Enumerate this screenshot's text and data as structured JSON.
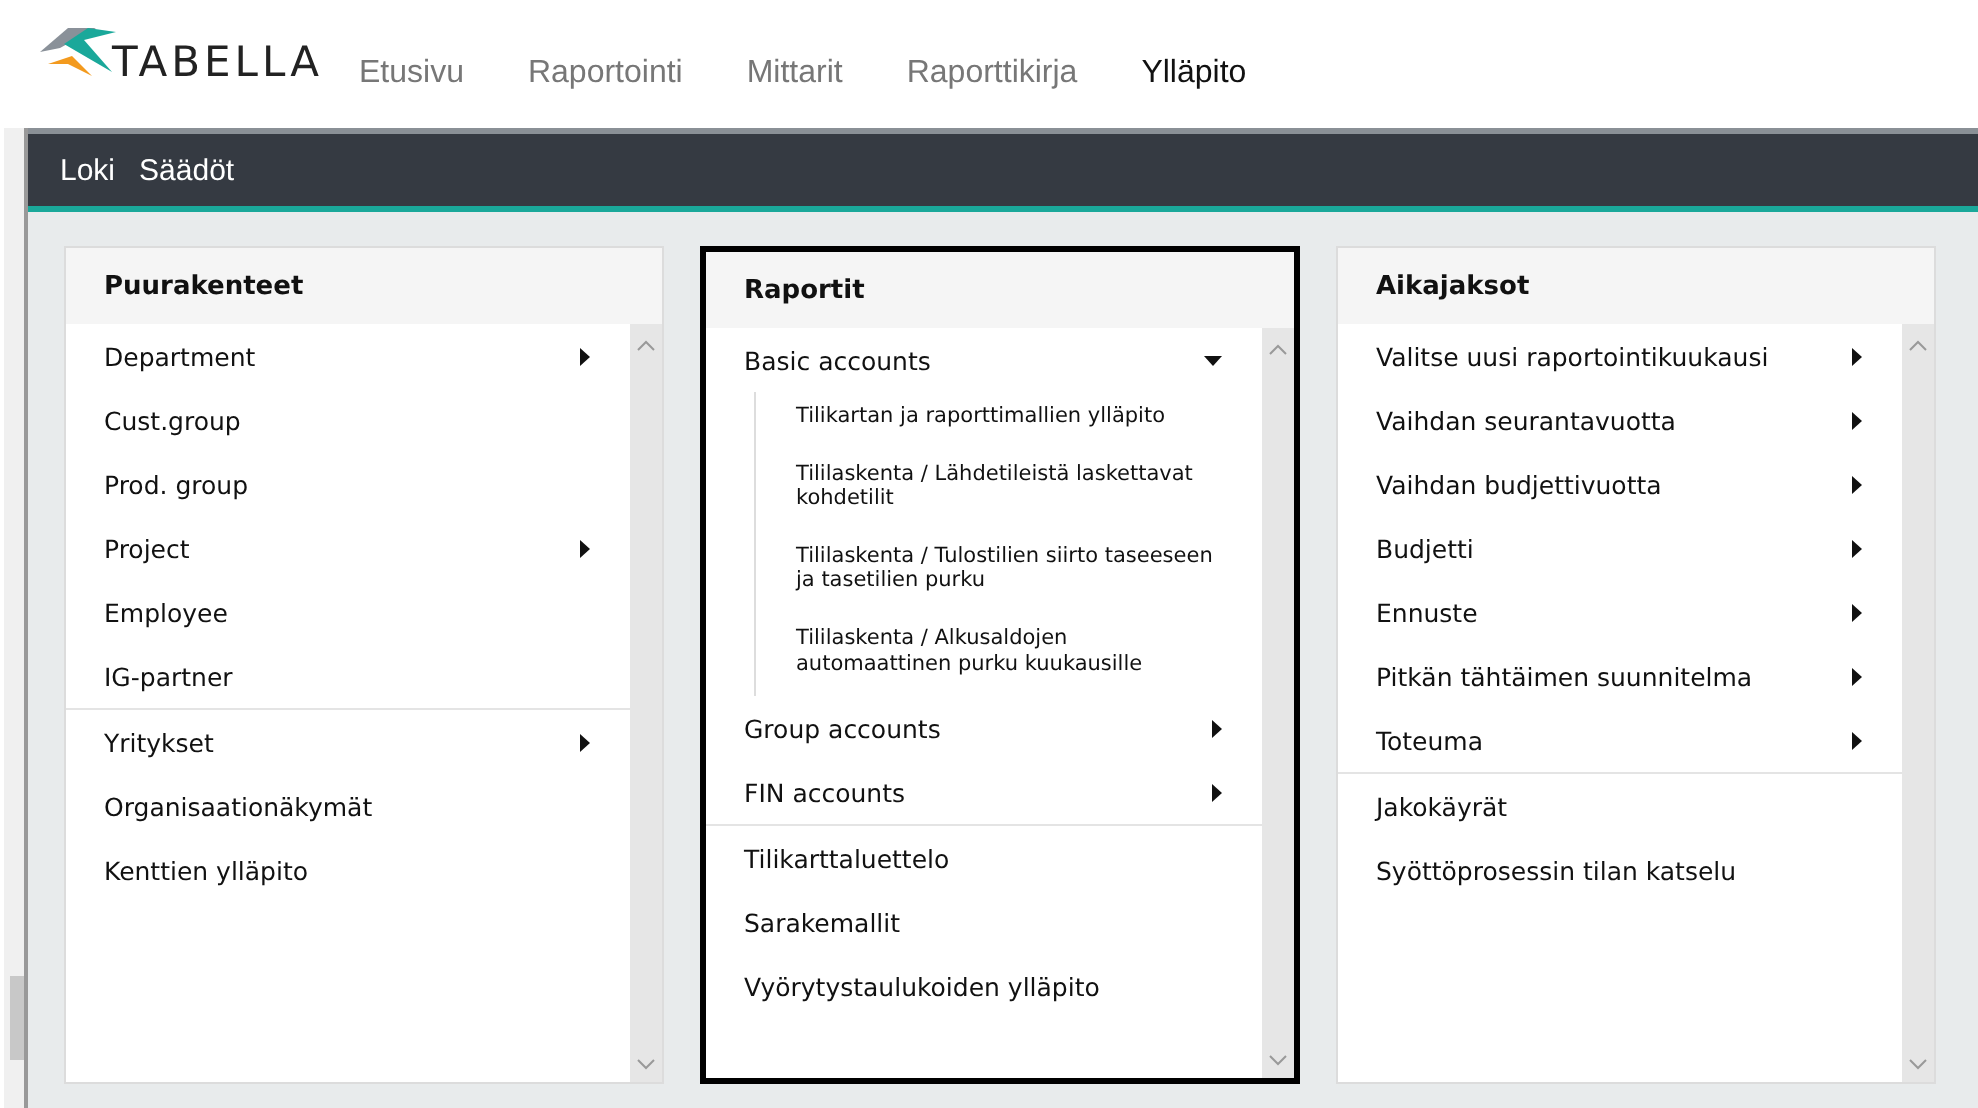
{
  "logo": {
    "text": "TABELLA"
  },
  "nav": [
    {
      "label": "Etusivu",
      "selected": false
    },
    {
      "label": "Raportointi",
      "selected": false
    },
    {
      "label": "Mittarit",
      "selected": false
    },
    {
      "label": "Raporttikirja",
      "selected": false
    },
    {
      "label": "Ylläpito",
      "selected": true
    }
  ],
  "subnav": [
    "Loki",
    "Säädöt"
  ],
  "panels": [
    {
      "title": "Puurakenteet",
      "highlighted": false,
      "groups": [
        [
          {
            "label": "Department",
            "submenu": true
          },
          {
            "label": "Cust.group",
            "submenu": false
          },
          {
            "label": "Prod. group",
            "submenu": false
          },
          {
            "label": "Project",
            "submenu": true
          },
          {
            "label": "Employee",
            "submenu": false
          },
          {
            "label": "IG-partner",
            "submenu": false
          }
        ],
        [
          {
            "label": "Yritykset",
            "submenu": true
          },
          {
            "label": "Organisaationäkymät",
            "submenu": false
          },
          {
            "label": "Kenttien ylläpito",
            "submenu": false
          }
        ]
      ]
    },
    {
      "title": "Raportit",
      "highlighted": true,
      "groups": [
        [
          {
            "label": "Basic accounts",
            "submenu": true,
            "expanded": true,
            "children": [
              "Tilikartan ja raporttimallien ylläpito",
              "Tililaskenta / Lähdetileistä laskettavat kohdetilit",
              "Tililaskenta / Tulostilien siirto taseeseen ja tasetilien purku",
              "Tililaskenta / Alkusaldojen automaattinen purku kuukausille"
            ]
          },
          {
            "label": "Group accounts",
            "submenu": true,
            "expanded": false
          },
          {
            "label": "FIN accounts",
            "submenu": true,
            "expanded": false
          }
        ],
        [
          {
            "label": "Tilikarttaluettelo",
            "submenu": false
          },
          {
            "label": "Sarakemallit",
            "submenu": false
          },
          {
            "label": "Vyörytystaulukoiden ylläpito",
            "submenu": false
          }
        ]
      ]
    },
    {
      "title": "Aikajaksot",
      "highlighted": false,
      "groups": [
        [
          {
            "label": "Valitse uusi raportointikuukausi",
            "submenu": true
          },
          {
            "label": "Vaihdan seurantavuotta",
            "submenu": true
          },
          {
            "label": "Vaihdan budjettivuotta",
            "submenu": true
          },
          {
            "label": "Budjetti",
            "submenu": true
          },
          {
            "label": "Ennuste",
            "submenu": true
          },
          {
            "label": "Pitkän tähtäimen suunnitelma",
            "submenu": true
          },
          {
            "label": "Toteuma",
            "submenu": true
          }
        ],
        [
          {
            "label": "Jakokäyrät",
            "submenu": false
          },
          {
            "label": "Syöttöprosessin tilan katselu",
            "submenu": false
          }
        ]
      ]
    }
  ]
}
